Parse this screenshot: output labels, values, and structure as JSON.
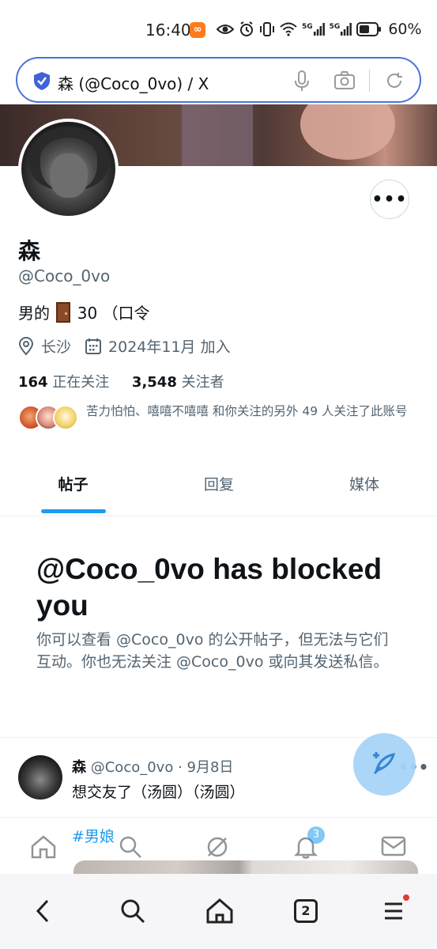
{
  "status_bar": {
    "time": "16:40",
    "app_badge": "∞",
    "signal1": "5G",
    "signal2": "5G",
    "battery": "60%"
  },
  "url_bar": {
    "text": "森 (@Coco_0vo) / X"
  },
  "profile": {
    "name": "森",
    "handle": "@Coco_0vo",
    "bio_prefix": "男的",
    "bio_suffix": "30 （口令",
    "location": "长沙",
    "joined": "2024年11月 加入",
    "following_count": "164",
    "following_label": "正在关注",
    "followers_count": "3,548",
    "followers_label": "关注者",
    "mutuals_text": "苦力怕怕、嘻嘻不嘻嘻 和你关注的另外 49 人关注了此账号",
    "more_label": "•••"
  },
  "tabs": [
    {
      "label": "帖子",
      "active": true
    },
    {
      "label": "回复",
      "active": false
    },
    {
      "label": "媒体",
      "active": false
    }
  ],
  "blocked": {
    "title": "@Coco_0vo has blocked you",
    "message": "你可以查看 @Coco_0vo 的公开帖子，但无法与它们互动。你也无法关注 @Coco_0vo 或向其发送私信。"
  },
  "post": {
    "author": "森",
    "meta": "@Coco_0vo · 9月8日",
    "text": "想交友了（汤圆）（汤圆）",
    "hashtag": "#男娘",
    "more": "•••"
  },
  "x_nav": {
    "notification_count": "3"
  },
  "browser_nav": {
    "tab_count": "2"
  },
  "colors": {
    "accent": "#1d9bf0",
    "secondary_text": "#536471",
    "url_border": "#4a74d9"
  }
}
